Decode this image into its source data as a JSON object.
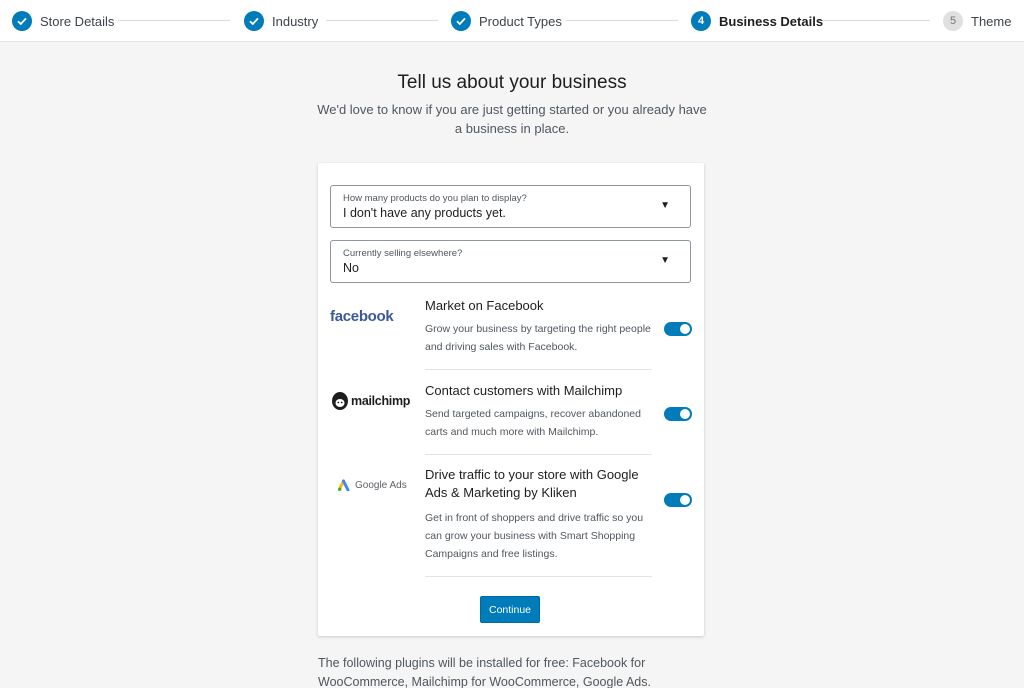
{
  "stepper": {
    "steps": [
      {
        "label": "Store Details",
        "status": "done"
      },
      {
        "label": "Industry",
        "status": "done"
      },
      {
        "label": "Product Types",
        "status": "done"
      },
      {
        "label": "Business Details",
        "status": "current",
        "number": "4"
      },
      {
        "label": "Theme",
        "status": "todo",
        "number": "5"
      }
    ]
  },
  "heading": {
    "title": "Tell us about your business",
    "subtitle": "We'd love to know if you are just getting started or you already have a business in place."
  },
  "form": {
    "products": {
      "label": "How many products do you plan to display?",
      "value": "I don't have any products yet."
    },
    "selling": {
      "label": "Currently selling elsewhere?",
      "value": "No"
    }
  },
  "extensions": [
    {
      "logo_text": "facebook",
      "title": "Market on Facebook",
      "description": "Grow your business by targeting the right people and driving sales with Facebook.",
      "enabled": true
    },
    {
      "logo_text": "mailchimp",
      "title": "Contact customers with Mailchimp",
      "description": "Send targeted campaigns, recover abandoned carts and much more with Mailchimp.",
      "enabled": true
    },
    {
      "logo_text": "Google Ads",
      "title": "Drive traffic to your store with Google Ads & Marketing by Kliken",
      "description": "Get in front of shoppers and drive traffic so you can grow your business with Smart Shopping Campaigns and free listings.",
      "enabled": true
    }
  ],
  "continue_label": "Continue",
  "footer_note": "The following plugins will be installed for free: Facebook for WooCommerce, Mailchimp for WooCommerce, Google Ads.",
  "colors": {
    "accent": "#007cba",
    "facebook": "#3b5998"
  },
  "icons": {
    "done": "check-icon",
    "caret": "caret-down-icon"
  }
}
